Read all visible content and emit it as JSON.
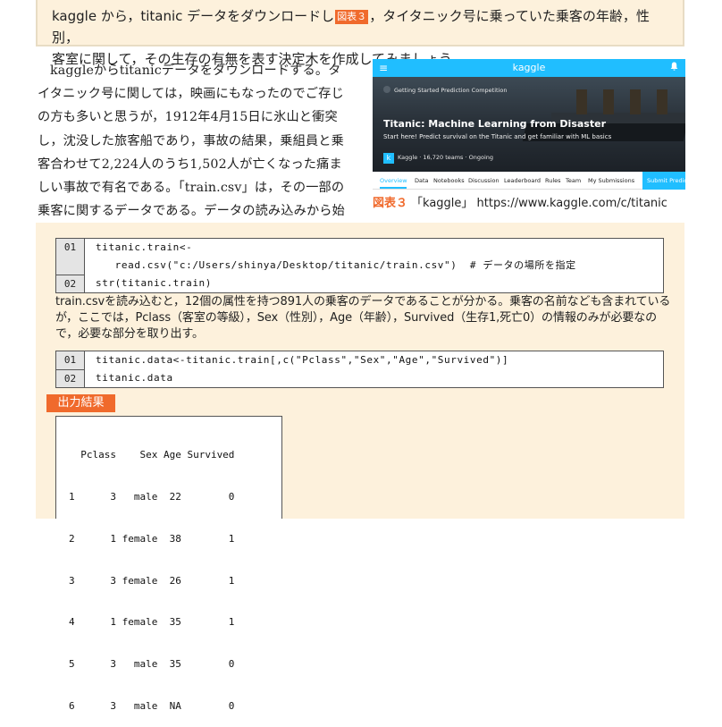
{
  "intro": {
    "line1_pre": "kaggle から，titanic データをダウンロードし",
    "fig_ref": "図表３",
    "line1_post": "，タイタニック号に乗っていた乗客の年齢，性別，",
    "line2": "客室に関して，その生存の有無を表す決定木を作成してみましょう。"
  },
  "body_text": "kaggleからtitanicデータをダウンロードする。タイタニック号に関しては，映画にもなったのでご存じの方も多いと思うが，1912年4月15日に氷山と衝突し，沈没した旅客船であり，事故の結果，乗組員と乗客合わせて2,224人のうち1,502人が亡くなった痛ましい事故で有名である。「train.csv」は，その一部の乗客に関するデータである。データの読み込みから始める。",
  "figure": {
    "menu_icon": "≡",
    "brand": "kaggle",
    "bell_icon": "🔔",
    "competition_label": "Getting Started Prediction Competition",
    "title": "Titanic: Machine Learning from Disaster",
    "subtitle": "Start here! Predict survival on the Titanic and get familiar with ML basics",
    "meta_logo": "k",
    "meta": "Kaggle · 16,720 teams · Ongoing",
    "nav": [
      "Overview",
      "Data",
      "Notebooks",
      "Discussion",
      "Leaderboard",
      "Rules",
      "Team",
      "My Submissions"
    ],
    "submit": "Submit Predictions",
    "caption_num": "図表３",
    "caption_text": "「kaggle」 https://www.kaggle.com/c/titanic"
  },
  "code1": [
    {
      "ln": "01",
      "text": "titanic.train<-"
    },
    {
      "ln": "",
      "text": "   read.csv(\"c:/Users/shinya/Desktop/titanic/train.csv\")  # データの場所を指定"
    },
    {
      "ln": "02",
      "text": "str(titanic.train)"
    }
  ],
  "mid_text": "train.csvを読み込むと，12個の属性を持つ891人の乗客のデータであることが分かる。乗客の名前なども含まれているが，ここでは，Pclass（客室の等級），Sex（性別），Age（年齢），Survived（生存1,死亡0）の情報のみが必要なので，必要な部分を取り出す。",
  "code2": [
    {
      "ln": "01",
      "text": "titanic.data<-titanic.train[,c(\"Pclass\",\"Sex\",\"Age\",\"Survived\")]"
    },
    {
      "ln": "02",
      "text": "titanic.data"
    }
  ],
  "output_label": "出力結果",
  "output": [
    "  Pclass    Sex Age Survived",
    "1      3   male  22        0",
    "2      1 female  38        1",
    "3      3 female  26        1",
    "4      1 female  35        1",
    "5      3   male  35        0",
    "6      3   male  NA        0"
  ]
}
